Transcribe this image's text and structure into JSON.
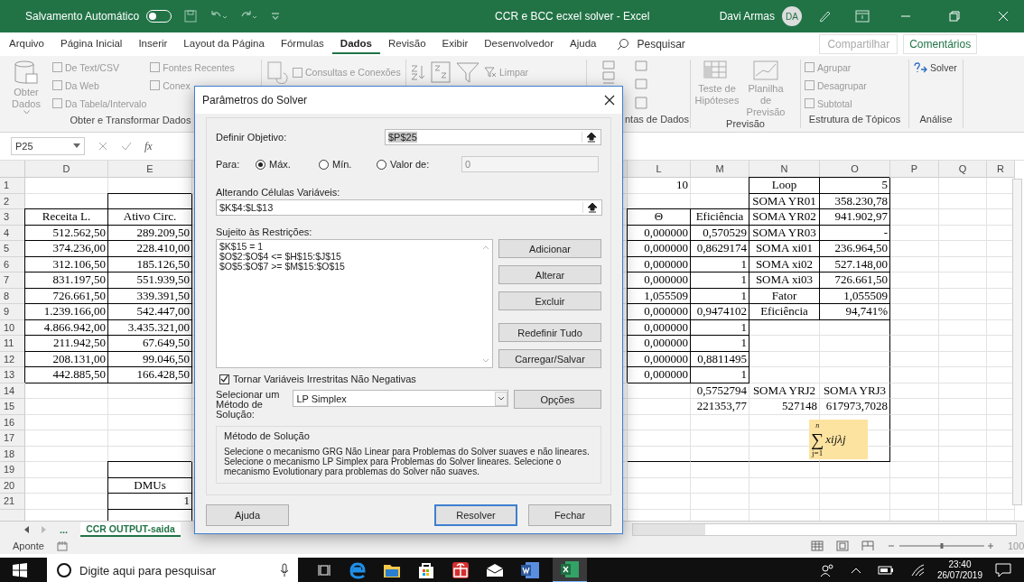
{
  "title_bar": {
    "autosave_label": "Salvamento Automático",
    "autosave_on": false,
    "title": "CCR e BCC ecxel solver  -  Excel",
    "user": "Davi Armas",
    "avatar": "DA"
  },
  "menu_tabs": [
    {
      "label": "Arquivo",
      "selected": false
    },
    {
      "label": "Página Inicial",
      "selected": false
    },
    {
      "label": "Inserir",
      "selected": false
    },
    {
      "label": "Layout da Página",
      "selected": false
    },
    {
      "label": "Fórmulas",
      "selected": false
    },
    {
      "label": "Dados",
      "selected": true
    },
    {
      "label": "Revisão",
      "selected": false
    },
    {
      "label": "Exibir",
      "selected": false
    },
    {
      "label": "Desenvolvedor",
      "selected": false
    },
    {
      "label": "Ajuda",
      "selected": false
    }
  ],
  "search": {
    "placeholder": "Pesquisar"
  },
  "share_button": "Compartilhar",
  "comments_button": "Comentários",
  "ribbon": {
    "get_data": {
      "big": "Obter Dados",
      "items": [
        "De Text/CSV",
        "Da Web",
        "Da Tabela/Intervalo"
      ],
      "items2": [
        "Fontes Recentes",
        "Conex"
      ],
      "label": "Obter e Transformar Dados"
    },
    "queries": {
      "item": "Consultas e Conexões"
    },
    "sort_filter": {
      "item": "Limpar"
    },
    "data_tools": {
      "label": "ntas de Dados"
    },
    "forecast": {
      "items": [
        "Teste de Hipóteses",
        "Planilha de Previsão"
      ],
      "label": "Previsão"
    },
    "outline": {
      "items": [
        "Agrupar",
        "Desagrupar",
        "Subtotal"
      ],
      "label": "Estrutura de Tópicos"
    },
    "analysis": {
      "item": "Solver",
      "label": "Análise"
    }
  },
  "formula_bar": {
    "name_box": "P25",
    "function_symbol": "fx"
  },
  "sheet": {
    "columns": [
      "D",
      "E",
      "L",
      "M",
      "N",
      "O",
      "P",
      "Q",
      "R"
    ],
    "rows": [
      {
        "number": "1",
        "cells": [
          null,
          null,
          "10",
          null,
          "Loop",
          "5"
        ]
      },
      {
        "number": "2",
        "cells": [
          null,
          null,
          null,
          null,
          "SOMA YR01",
          "358.230,78"
        ]
      },
      {
        "number": "3",
        "cells": [
          "Receita L.",
          "Ativo Circ.",
          "Θ",
          "Eficiência",
          "SOMA YR02",
          "941.902,97"
        ]
      },
      {
        "number": "4",
        "cells": [
          "512.562,50",
          "289.209,50",
          "0,000000",
          "0,570529",
          "SOMA YR03",
          "-"
        ]
      },
      {
        "number": "5",
        "cells": [
          "374.236,00",
          "228.410,00",
          "0,000000",
          "0,8629174",
          "SOMA xi01",
          "236.964,50"
        ]
      },
      {
        "number": "6",
        "cells": [
          "312.106,50",
          "185.126,50",
          "0,000000",
          "1",
          "SOMA xi02",
          "527.148,00"
        ]
      },
      {
        "number": "7",
        "cells": [
          "831.197,50",
          "551.939,50",
          "0,000000",
          "1",
          "SOMA xi03",
          "726.661,50"
        ]
      },
      {
        "number": "8",
        "cells": [
          "726.661,50",
          "339.391,50",
          "1,055509",
          "1",
          "Fator",
          "1,055509"
        ]
      },
      {
        "number": "9",
        "cells": [
          "1.239.166,00",
          "542.447,00",
          "0,000000",
          "0,9474102",
          "Eficiência",
          "94,741%"
        ]
      },
      {
        "number": "10",
        "cells": [
          "4.866.942,00",
          "3.435.321,00",
          "0,000000",
          "1"
        ]
      },
      {
        "number": "11",
        "cells": [
          "211.942,50",
          "67.649,50",
          "0,000000",
          "1"
        ]
      },
      {
        "number": "12",
        "cells": [
          "208.131,00",
          "99.046,50",
          "0,000000",
          "0,8811495"
        ]
      },
      {
        "number": "13",
        "cells": [
          "442.885,50",
          "166.428,50",
          "0,000000",
          "1"
        ]
      },
      {
        "number": "14",
        "cells": [
          null,
          null,
          null,
          "0,5752794",
          "SOMA YRJ2",
          "SOMA YRJ3"
        ]
      },
      {
        "number": "15",
        "cells": [
          null,
          null,
          null,
          "221353,77",
          "527148",
          "617973,7028"
        ]
      },
      {
        "number": "16",
        "cells": []
      },
      {
        "number": "17",
        "cells": []
      },
      {
        "number": "18",
        "cells": []
      },
      {
        "number": "19",
        "cells": []
      },
      {
        "number": "20",
        "cells": [
          null,
          "DMUs"
        ]
      },
      {
        "number": "21",
        "cells": [
          null,
          "1"
        ]
      }
    ],
    "formula_object": {
      "upper": "n",
      "symbol": "∑",
      "lower": "j=1",
      "term": "xijλj"
    }
  },
  "sheet_tabs": [
    {
      "label": "...",
      "selected": false
    },
    {
      "label": "CCR OUTPUT-saida",
      "selected": true
    }
  ],
  "status_bar": {
    "mode": "Aponte",
    "zoom": "100",
    "zoom_slider": {
      "level": 0.5
    }
  },
  "solver_dialog": {
    "title": "Parâmetros do Solver",
    "objective_label": "Definir Objetivo:",
    "objective_value": "$P$25",
    "to_label": "Para:",
    "options": [
      {
        "label": "Máx.",
        "selected": true
      },
      {
        "label": "Mín.",
        "selected": false
      },
      {
        "label": "Valor de:",
        "selected": false
      }
    ],
    "value_field": {
      "value": "0",
      "disabled": true
    },
    "changing_label": "Alterando Células Variáveis:",
    "changing_value": "$K$4:$L$13",
    "constraints_label": "Sujeito às Restrições:",
    "constraints": [
      "$K$15 = 1",
      "$O$2:$O$4 <= $H$15:$J$15",
      "$O$5:$O$7 >= $M$15:$O$15"
    ],
    "side_buttons": [
      "Adicionar",
      "Alterar",
      "Excluir",
      "Redefinir Tudo",
      "Carregar/Salvar"
    ],
    "nonneg": {
      "label": "Tornar Variáveis Irrestritas Não Negativas",
      "checked": true
    },
    "method_label": "Selecionar um Método de Solução:",
    "method_value": "LP Simplex",
    "options_button": "Opções",
    "method_group": {
      "title": "Método de Solução",
      "text": "Selecione o mecanismo GRG Não Linear para Problemas do Solver suaves e não lineares. Selecione o mecanismo LP Simplex para Problemas do Solver lineares. Selecione o mecanismo Evolutionary para problemas do Solver não suaves."
    },
    "buttons": [
      {
        "label": "Ajuda",
        "default": false
      },
      {
        "label": "Resolver",
        "default": true
      },
      {
        "label": "Fechar",
        "default": false
      }
    ]
  },
  "taskbar": {
    "search_placeholder": "Digite aqui para pesquisar",
    "time": "23:40",
    "date": "26/07/2019"
  }
}
